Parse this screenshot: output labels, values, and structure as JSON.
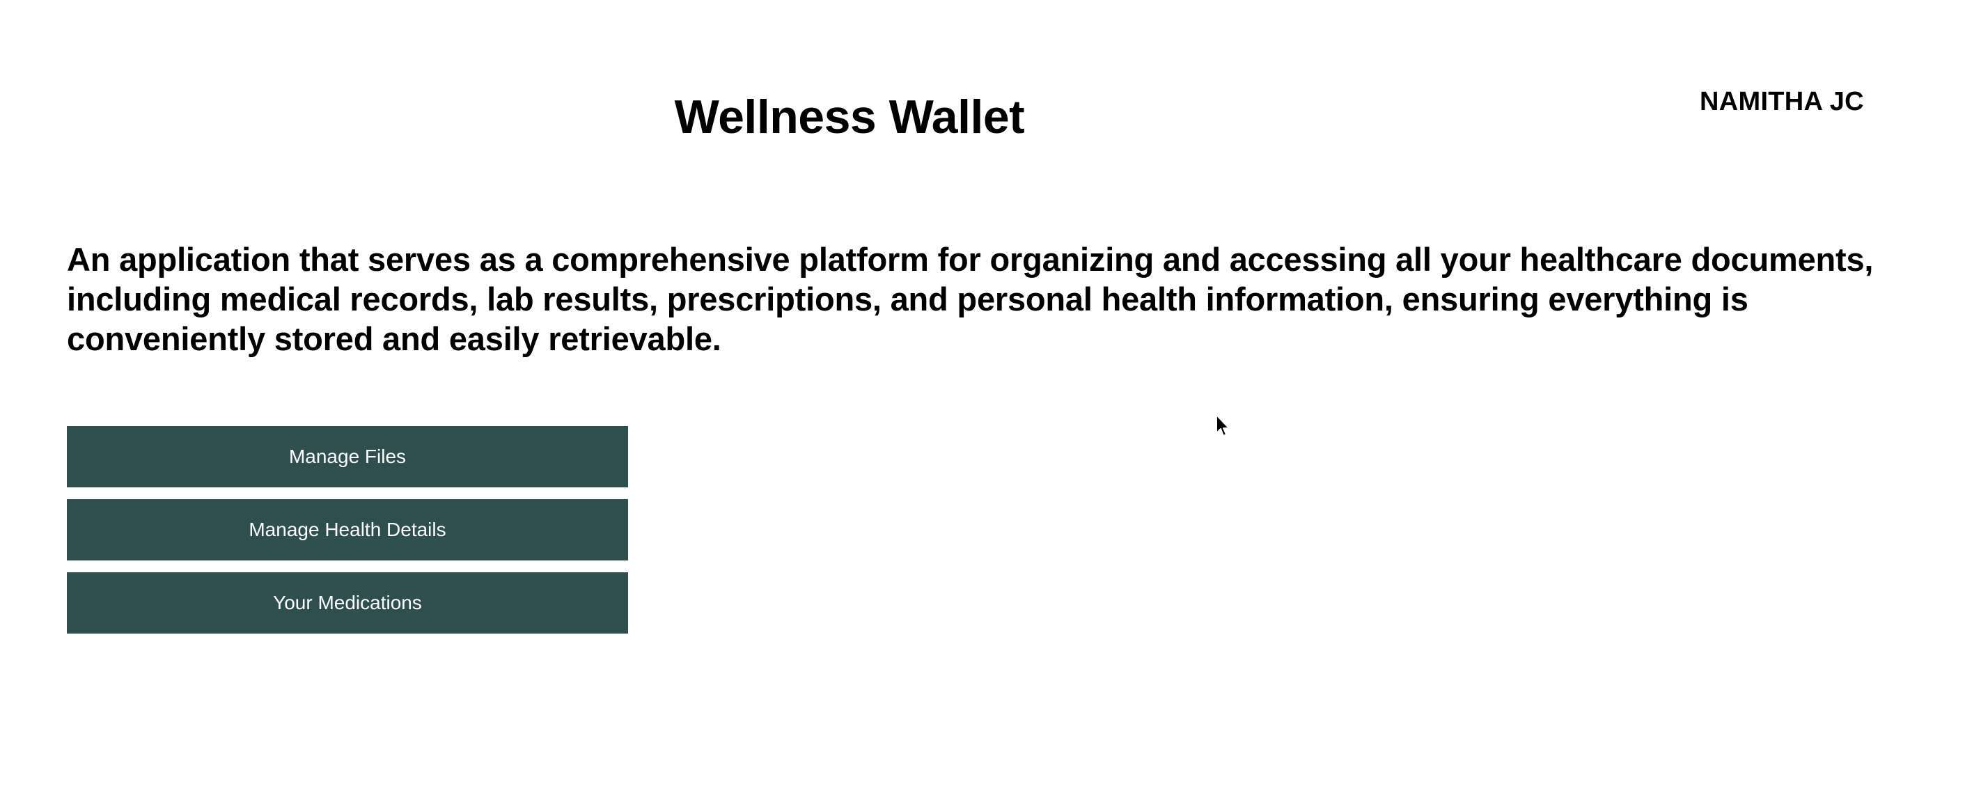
{
  "header": {
    "title": "Wellness Wallet",
    "user_name": "NAMITHA JC"
  },
  "main": {
    "description": "An application that serves as a comprehensive platform for organizing and accessing all your healthcare documents, including medical records, lab results, prescriptions, and personal health information, ensuring everything is conveniently stored and easily retrievable.",
    "buttons": [
      {
        "label": "Manage Files"
      },
      {
        "label": "Manage Health Details"
      },
      {
        "label": "Your Medications"
      }
    ]
  },
  "colors": {
    "button_background": "#2f4f4f",
    "button_text": "#ffffff",
    "page_background": "#ffffff",
    "text": "#000000"
  },
  "icons": {
    "cursor": "mouse-pointer-icon"
  }
}
